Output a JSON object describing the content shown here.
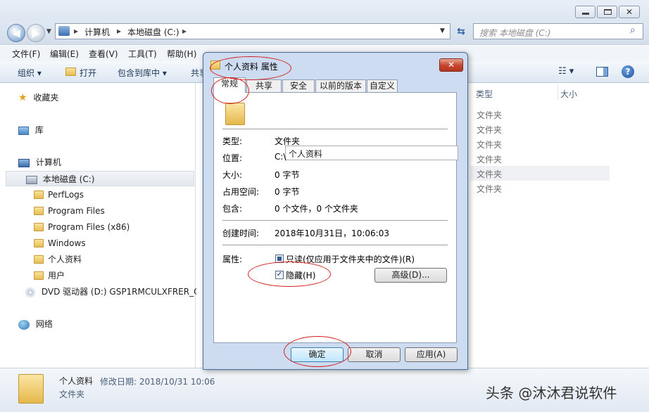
{
  "explorer": {
    "window_controls": {
      "min_icon": "minimize-icon",
      "max_icon": "maximize-icon",
      "close_glyph": "✕"
    },
    "address": {
      "crumbs": [
        "计算机",
        "本地磁盘 (C:)"
      ],
      "sep": "▸"
    },
    "search": {
      "placeholder": "搜索 本地磁盘 (C:)"
    },
    "menu": [
      "文件(F)",
      "编辑(E)",
      "查看(V)",
      "工具(T)",
      "帮助(H)"
    ],
    "toolbar": {
      "organize": "组织 ▾",
      "open": "打开",
      "include": "包含到库中 ▾",
      "share": "共享"
    },
    "nav": {
      "favorites": "收藏夹",
      "libraries": "库",
      "computer": "计算机",
      "drive_c": "本地磁盘 (C:)",
      "folders": [
        "PerfLogs",
        "Program Files",
        "Program Files (x86)",
        "Windows",
        "个人资料",
        "用户"
      ],
      "dvd": "DVD 驱动器 (D:) GSP1RMCULXFRER_C",
      "network": "网络"
    },
    "columns": {
      "type": "类型",
      "size": "大小"
    },
    "type_cells": [
      "文件夹",
      "文件夹",
      "文件夹",
      "文件夹",
      "文件夹",
      "文件夹"
    ],
    "details": {
      "name": "个人资料",
      "modified": "修改日期: 2018/10/31 10:06",
      "type": "文件夹"
    },
    "watermark": "头条 @沐沐君说软件"
  },
  "dialog": {
    "title": "个人资料 属性",
    "close_glyph": "✕",
    "tabs": [
      "常规",
      "共享",
      "安全",
      "以前的版本",
      "自定义"
    ],
    "folder_name": "个人资料",
    "props": [
      {
        "label": "类型:",
        "value": "文件夹"
      },
      {
        "label": "位置:",
        "value": "C:\\"
      },
      {
        "label": "大小:",
        "value": "0 字节"
      },
      {
        "label": "占用空间:",
        "value": "0 字节"
      },
      {
        "label": "包含:",
        "value": "0 个文件，0 个文件夹"
      }
    ],
    "created": {
      "label": "创建时间:",
      "value": "2018年10月31日，10:06:03"
    },
    "attributes": {
      "label": "属性:",
      "readonly": "只读(仅应用于文件夹中的文件)(R)",
      "readonly_state": "indeterminate",
      "hidden": "隐藏(H)",
      "hidden_checked": true,
      "check_glyph": "✓",
      "advanced": "高级(D)..."
    },
    "buttons": {
      "ok": "确定",
      "cancel": "取消",
      "apply": "应用(A)"
    }
  },
  "colors": {
    "annotation_red": "#d22020",
    "dialog_frame": "#cddcf0"
  }
}
